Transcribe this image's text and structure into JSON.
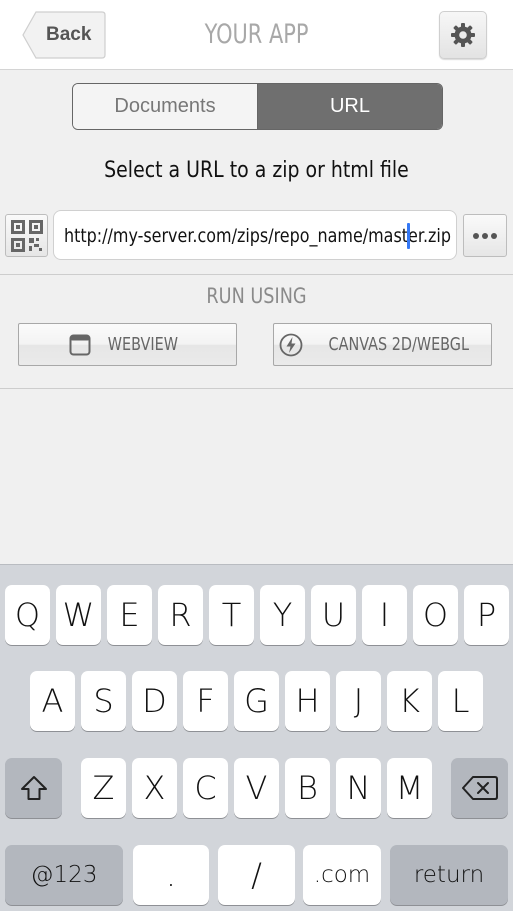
{
  "header": {
    "back_label": "Back",
    "title": "YOUR APP"
  },
  "segmented": {
    "documents_label": "Documents",
    "url_label": "URL",
    "selected": "URL"
  },
  "url_section": {
    "prompt": "Select a URL to a zip or html file",
    "value": "http://my-server.com/zips/repo_name/master.zip"
  },
  "run": {
    "label": "RUN USING",
    "webview_label": "WEBVIEW",
    "canvas_label": "CANVAS 2D/WEBGL"
  },
  "keyboard": {
    "row1": [
      "Q",
      "W",
      "E",
      "R",
      "T",
      "Y",
      "U",
      "I",
      "O",
      "P"
    ],
    "row2": [
      "A",
      "S",
      "D",
      "F",
      "G",
      "H",
      "J",
      "K",
      "L"
    ],
    "row3": [
      "Z",
      "X",
      "C",
      "V",
      "B",
      "N",
      "M"
    ],
    "numbers_label": "@123",
    "dot_label": ".",
    "slash_label": "/",
    "com_label": ".com",
    "return_label": "return"
  },
  "icons": [
    "chevron-back-icon",
    "gear-icon",
    "qr-code-icon",
    "more-icon",
    "window-icon",
    "lightning-icon",
    "shift-icon",
    "backspace-icon"
  ],
  "colors": {
    "accent_caret": "#3478f6",
    "segment_selected": "#6f6f6f",
    "keyboard_bg": "#d2d5da"
  }
}
